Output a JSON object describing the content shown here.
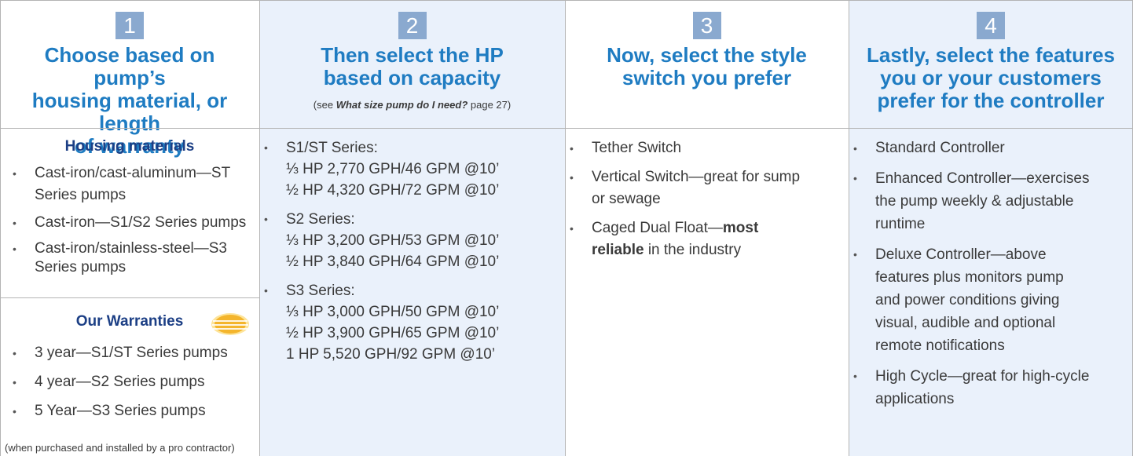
{
  "columns": [
    {
      "number": "1",
      "title_lines": [
        "Choose based on pump’s",
        "housing material, or length",
        "of warranty"
      ]
    },
    {
      "number": "2",
      "title_lines": [
        "Then select the HP",
        "based on capacity"
      ],
      "note_prefix": "(see ",
      "note_emph": "What size pump do I need?",
      "note_suffix": " page 27)"
    },
    {
      "number": "3",
      "title_lines": [
        "Now, select the style",
        "switch you prefer"
      ]
    },
    {
      "number": "4",
      "title_lines": [
        "Lastly, select the features",
        "you or your customers",
        "prefer for the controller"
      ]
    }
  ],
  "housing": {
    "title": "Housing materials",
    "items": [
      [
        "Cast-iron/cast-aluminum—ST",
        "Series pumps"
      ],
      [
        "Cast-iron—S1/S2 Series pumps"
      ],
      [
        "Cast-iron/stainless-steel—S3",
        "Series pumps"
      ]
    ]
  },
  "warranties": {
    "title": "Our Warranties",
    "badge_icon": "warranty-seal-icon",
    "badge_color": "#f4b52c",
    "items": [
      "3 year—S1/ST Series pumps",
      "4 year—S2 Series pumps",
      "5 Year—S3 Series pumps"
    ],
    "footnote": "(when purchased and installed by a pro contractor)"
  },
  "capacity": [
    {
      "series": "S1/ST Series:",
      "lines": [
        "⅓ HP 2,770 GPH/46 GPM @10’",
        "½ HP 4,320 GPH/72 GPM @10’"
      ]
    },
    {
      "series": "S2 Series:",
      "lines": [
        "⅓ HP 3,200 GPH/53 GPM @10’",
        "½ HP 3,840 GPH/64 GPM @10’"
      ]
    },
    {
      "series": "S3 Series:",
      "lines": [
        "⅓ HP 3,000 GPH/50 GPM @10’",
        "½ HP 3,900 GPH/65 GPM @10’",
        "1 HP 5,520 GPH/92 GPM @10’"
      ]
    }
  ],
  "switches": {
    "tether": "Tether Switch",
    "vertical": [
      "Vertical Switch—great for sump",
      "or sewage"
    ],
    "caged_line1_prefix": "Caged Dual Float—",
    "caged_line1_bold": "most",
    "caged_line2_bold": "reliable",
    "caged_line2_rest": " in the industry"
  },
  "controllers": [
    [
      "Standard Controller"
    ],
    [
      "Enhanced Controller—exercises",
      "the pump weekly & adjustable",
      "runtime"
    ],
    [
      "Deluxe Controller—above",
      "features plus monitors pump",
      "and power conditions giving",
      "visual, audible and optional",
      "remote notifications"
    ],
    [
      "High Cycle—great for high-cycle",
      "applications"
    ]
  ],
  "colors": {
    "title_blue": "#1f7cc2",
    "section_navy": "#1c3f85",
    "number_box": "#8aa9cf",
    "column_tint": "#eaf1fb"
  }
}
